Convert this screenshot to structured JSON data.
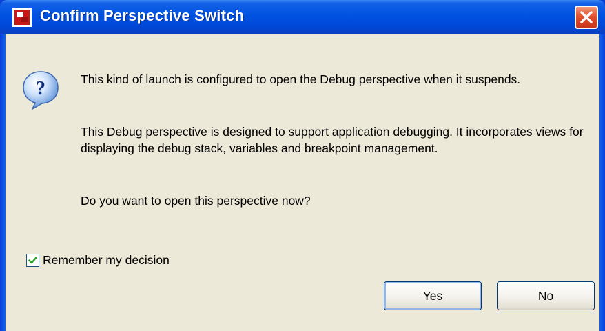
{
  "window": {
    "title": "Confirm Perspective Switch",
    "titlebar_color": "#0052e0",
    "close_button_color": "#e2532f"
  },
  "dialog": {
    "icon": "question-icon",
    "messages": [
      "This kind of launch is configured to open the Debug perspective when it suspends.",
      "This Debug perspective is designed to support application debugging.  It incorporates views for displaying the debug stack, variables and breakpoint management.",
      "Do you want to open this perspective now?"
    ],
    "remember_checkbox": {
      "label": "Remember my decision",
      "checked": true
    },
    "buttons": {
      "yes_label": "Yes",
      "no_label": "No"
    }
  }
}
